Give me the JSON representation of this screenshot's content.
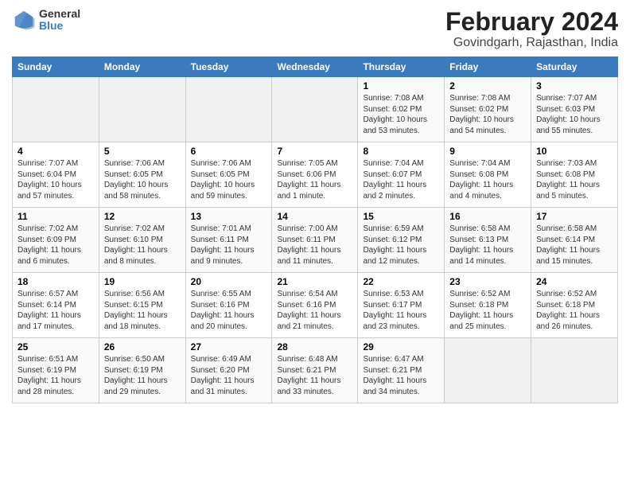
{
  "logo": {
    "general": "General",
    "blue": "Blue"
  },
  "title": "February 2024",
  "subtitle": "Govindgarh, Rajasthan, India",
  "days_of_week": [
    "Sunday",
    "Monday",
    "Tuesday",
    "Wednesday",
    "Thursday",
    "Friday",
    "Saturday"
  ],
  "weeks": [
    [
      {
        "day": "",
        "info": ""
      },
      {
        "day": "",
        "info": ""
      },
      {
        "day": "",
        "info": ""
      },
      {
        "day": "",
        "info": ""
      },
      {
        "day": "1",
        "info": "Sunrise: 7:08 AM\nSunset: 6:02 PM\nDaylight: 10 hours\nand 53 minutes."
      },
      {
        "day": "2",
        "info": "Sunrise: 7:08 AM\nSunset: 6:02 PM\nDaylight: 10 hours\nand 54 minutes."
      },
      {
        "day": "3",
        "info": "Sunrise: 7:07 AM\nSunset: 6:03 PM\nDaylight: 10 hours\nand 55 minutes."
      }
    ],
    [
      {
        "day": "4",
        "info": "Sunrise: 7:07 AM\nSunset: 6:04 PM\nDaylight: 10 hours\nand 57 minutes."
      },
      {
        "day": "5",
        "info": "Sunrise: 7:06 AM\nSunset: 6:05 PM\nDaylight: 10 hours\nand 58 minutes."
      },
      {
        "day": "6",
        "info": "Sunrise: 7:06 AM\nSunset: 6:05 PM\nDaylight: 10 hours\nand 59 minutes."
      },
      {
        "day": "7",
        "info": "Sunrise: 7:05 AM\nSunset: 6:06 PM\nDaylight: 11 hours\nand 1 minute."
      },
      {
        "day": "8",
        "info": "Sunrise: 7:04 AM\nSunset: 6:07 PM\nDaylight: 11 hours\nand 2 minutes."
      },
      {
        "day": "9",
        "info": "Sunrise: 7:04 AM\nSunset: 6:08 PM\nDaylight: 11 hours\nand 4 minutes."
      },
      {
        "day": "10",
        "info": "Sunrise: 7:03 AM\nSunset: 6:08 PM\nDaylight: 11 hours\nand 5 minutes."
      }
    ],
    [
      {
        "day": "11",
        "info": "Sunrise: 7:02 AM\nSunset: 6:09 PM\nDaylight: 11 hours\nand 6 minutes."
      },
      {
        "day": "12",
        "info": "Sunrise: 7:02 AM\nSunset: 6:10 PM\nDaylight: 11 hours\nand 8 minutes."
      },
      {
        "day": "13",
        "info": "Sunrise: 7:01 AM\nSunset: 6:11 PM\nDaylight: 11 hours\nand 9 minutes."
      },
      {
        "day": "14",
        "info": "Sunrise: 7:00 AM\nSunset: 6:11 PM\nDaylight: 11 hours\nand 11 minutes."
      },
      {
        "day": "15",
        "info": "Sunrise: 6:59 AM\nSunset: 6:12 PM\nDaylight: 11 hours\nand 12 minutes."
      },
      {
        "day": "16",
        "info": "Sunrise: 6:58 AM\nSunset: 6:13 PM\nDaylight: 11 hours\nand 14 minutes."
      },
      {
        "day": "17",
        "info": "Sunrise: 6:58 AM\nSunset: 6:14 PM\nDaylight: 11 hours\nand 15 minutes."
      }
    ],
    [
      {
        "day": "18",
        "info": "Sunrise: 6:57 AM\nSunset: 6:14 PM\nDaylight: 11 hours\nand 17 minutes."
      },
      {
        "day": "19",
        "info": "Sunrise: 6:56 AM\nSunset: 6:15 PM\nDaylight: 11 hours\nand 18 minutes."
      },
      {
        "day": "20",
        "info": "Sunrise: 6:55 AM\nSunset: 6:16 PM\nDaylight: 11 hours\nand 20 minutes."
      },
      {
        "day": "21",
        "info": "Sunrise: 6:54 AM\nSunset: 6:16 PM\nDaylight: 11 hours\nand 21 minutes."
      },
      {
        "day": "22",
        "info": "Sunrise: 6:53 AM\nSunset: 6:17 PM\nDaylight: 11 hours\nand 23 minutes."
      },
      {
        "day": "23",
        "info": "Sunrise: 6:52 AM\nSunset: 6:18 PM\nDaylight: 11 hours\nand 25 minutes."
      },
      {
        "day": "24",
        "info": "Sunrise: 6:52 AM\nSunset: 6:18 PM\nDaylight: 11 hours\nand 26 minutes."
      }
    ],
    [
      {
        "day": "25",
        "info": "Sunrise: 6:51 AM\nSunset: 6:19 PM\nDaylight: 11 hours\nand 28 minutes."
      },
      {
        "day": "26",
        "info": "Sunrise: 6:50 AM\nSunset: 6:19 PM\nDaylight: 11 hours\nand 29 minutes."
      },
      {
        "day": "27",
        "info": "Sunrise: 6:49 AM\nSunset: 6:20 PM\nDaylight: 11 hours\nand 31 minutes."
      },
      {
        "day": "28",
        "info": "Sunrise: 6:48 AM\nSunset: 6:21 PM\nDaylight: 11 hours\nand 33 minutes."
      },
      {
        "day": "29",
        "info": "Sunrise: 6:47 AM\nSunset: 6:21 PM\nDaylight: 11 hours\nand 34 minutes."
      },
      {
        "day": "",
        "info": ""
      },
      {
        "day": "",
        "info": ""
      }
    ]
  ]
}
